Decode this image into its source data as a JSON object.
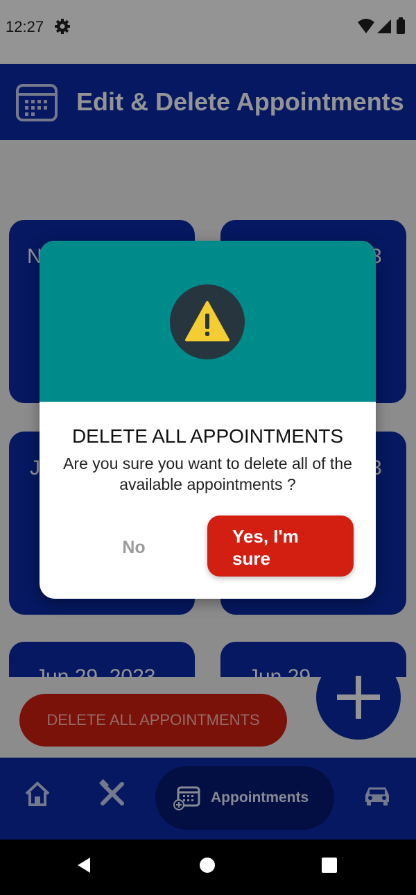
{
  "status_bar": {
    "time": "12:27"
  },
  "header": {
    "title": "Edit & Delete Appointments"
  },
  "cards": [
    {
      "text": "N"
    },
    {
      "text": "3"
    },
    {
      "text": "J"
    },
    {
      "text": "3"
    },
    {
      "text": "Jun 29, 2023"
    },
    {
      "text": "Jun 29"
    }
  ],
  "delete_all_label": "DELETE ALL APPOINTMENTS",
  "bottom_nav": {
    "active_label": "Appointments"
  },
  "dialog": {
    "title": "DELETE ALL APPOINTMENTS",
    "message": "Are you sure you want to delete all of the available appointments ?",
    "no_label": "No",
    "yes_label": "Yes, I'm sure"
  }
}
